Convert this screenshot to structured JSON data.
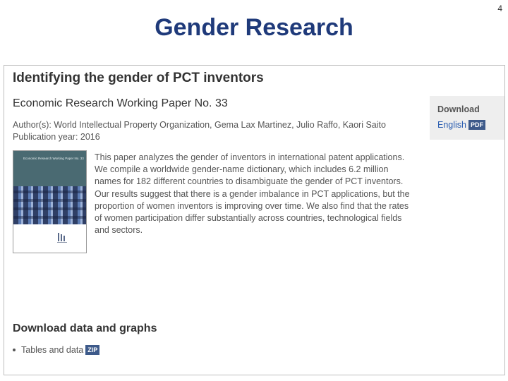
{
  "slide": {
    "title": "Gender Research",
    "page_number": "4"
  },
  "publication": {
    "title": "Identifying the gender of PCT inventors",
    "subtitle": "Economic Research Working Paper No. 33",
    "authors": "Author(s): World Intellectual Property Organization, Gema Lax Martinez, Julio Raffo, Kaori Saito",
    "year": "Publication year: 2016",
    "abstract": "This paper analyzes the gender of inventors in international patent applications. We compile a worldwide gender-name dictionary, which includes 6.2 million names for 182 different countries to disambiguate the gender of PCT inventors. Our results suggest that there is a gender imbalance in PCT applications, but the proportion of women inventors is improving over time. We also find that the rates of women participation differ substantially across countries, technological fields and sectors."
  },
  "download": {
    "heading": "Download",
    "link_label": "English",
    "file_type": "PDF"
  },
  "cover": {
    "series": "Economic Research Working Paper No. 33",
    "colors": {
      "band": "#4a6a72",
      "pattern_dark": "#2f3f66",
      "pattern_light": "#9db2d7"
    }
  },
  "data_section": {
    "heading": "Download data and graphs",
    "item_label": "Tables and data",
    "file_type": "ZIP"
  },
  "colors": {
    "title": "#1f3a7a",
    "link": "#2a5db0",
    "badge": "#3d5a8a",
    "panel": "#eeeeee"
  }
}
